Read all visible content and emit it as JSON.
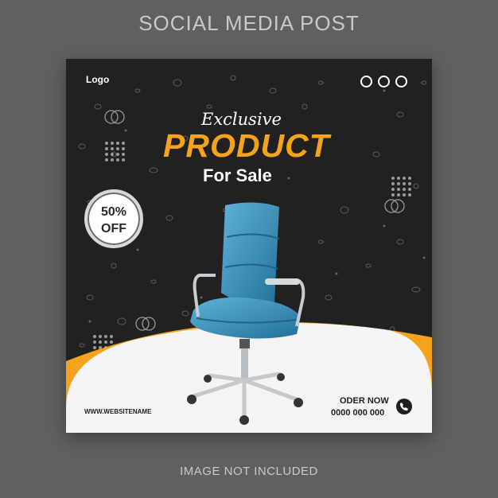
{
  "header": {
    "title": "SOCIAL MEDIA POST"
  },
  "footer": {
    "note": "IMAGE NOT INCLUDED"
  },
  "post": {
    "logo": "Logo",
    "heading_script": "Exclusive",
    "heading_main": "PRODUCT",
    "heading_sub": "For Sale",
    "discount_line1": "50%",
    "discount_line2": "OFF",
    "website": "WWW.WEBSITENAME",
    "order_title": "ODER NOW",
    "order_phone": "0000 000 000"
  },
  "colors": {
    "background": "#5f6062",
    "card": "#212121",
    "accent_orange": "#f5a21d",
    "chair_blue": "#3b8fb8"
  },
  "icons": [
    "menu-dots-icon",
    "phone-icon",
    "dot-grid-pattern",
    "circle-pattern"
  ]
}
